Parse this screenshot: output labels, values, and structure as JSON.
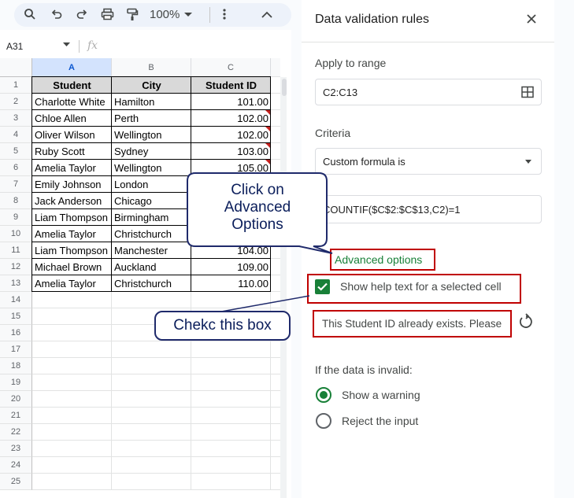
{
  "toolbar": {
    "zoom": "100%",
    "icons": [
      "search-icon",
      "undo-icon",
      "redo-icon",
      "print-icon",
      "paint-format-icon",
      "more-vert-icon",
      "chevron-up-icon"
    ]
  },
  "formula_bar": {
    "name_box": "A31",
    "fx": "fx"
  },
  "sheet": {
    "columns": [
      "A",
      "B",
      "C"
    ],
    "row_numbers": [
      "1",
      "2",
      "3",
      "4",
      "5",
      "6",
      "7",
      "8",
      "9",
      "10",
      "11",
      "12",
      "13",
      "14",
      "15",
      "16",
      "17",
      "18",
      "19",
      "20",
      "21",
      "22",
      "23",
      "24",
      "25"
    ],
    "header": [
      "Student",
      "City",
      "Student ID"
    ],
    "rows": [
      [
        "Charlotte White",
        "Hamilton",
        "101.00"
      ],
      [
        "Chloe Allen",
        "Perth",
        "102.00"
      ],
      [
        "Oliver Wilson",
        "Wellington",
        "102.00"
      ],
      [
        "Ruby Scott",
        "Sydney",
        "103.00"
      ],
      [
        "Amelia Taylor",
        "Wellington",
        "105.00"
      ],
      [
        "Emily Johnson",
        "London",
        ""
      ],
      [
        "Jack Anderson",
        "Chicago",
        ""
      ],
      [
        "Liam Thompson",
        "Birmingham",
        ""
      ],
      [
        "Amelia Taylor",
        "Christchurch",
        ""
      ],
      [
        "Liam Thompson",
        "Manchester",
        "104.00"
      ],
      [
        "Michael Brown",
        "Auckland",
        "109.00"
      ],
      [
        "Amelia Taylor",
        "Christchurch",
        "110.00"
      ]
    ]
  },
  "panel": {
    "title": "Data validation rules",
    "apply_label": "Apply to range",
    "range": "C2:C13",
    "criteria_label": "Criteria",
    "criteria": "Custom formula is",
    "formula": "COUNTIF($C$2:$C$13,C2)=1",
    "advanced": "Advanced options",
    "show_help": "Show help text for a selected cell",
    "help_text": "This Student ID already exists. Please",
    "invalid_label": "If the data is invalid:",
    "option_warning": "Show a warning",
    "option_reject": "Reject the input"
  },
  "callouts": {
    "advanced": "Click on Advanced Options",
    "checkbox": "Chekc this box"
  },
  "colors": {
    "accent_green": "#188038",
    "highlight_red": "#c00000",
    "callout_border": "#1f2a6b",
    "callout_text": "#0b1e5b"
  }
}
